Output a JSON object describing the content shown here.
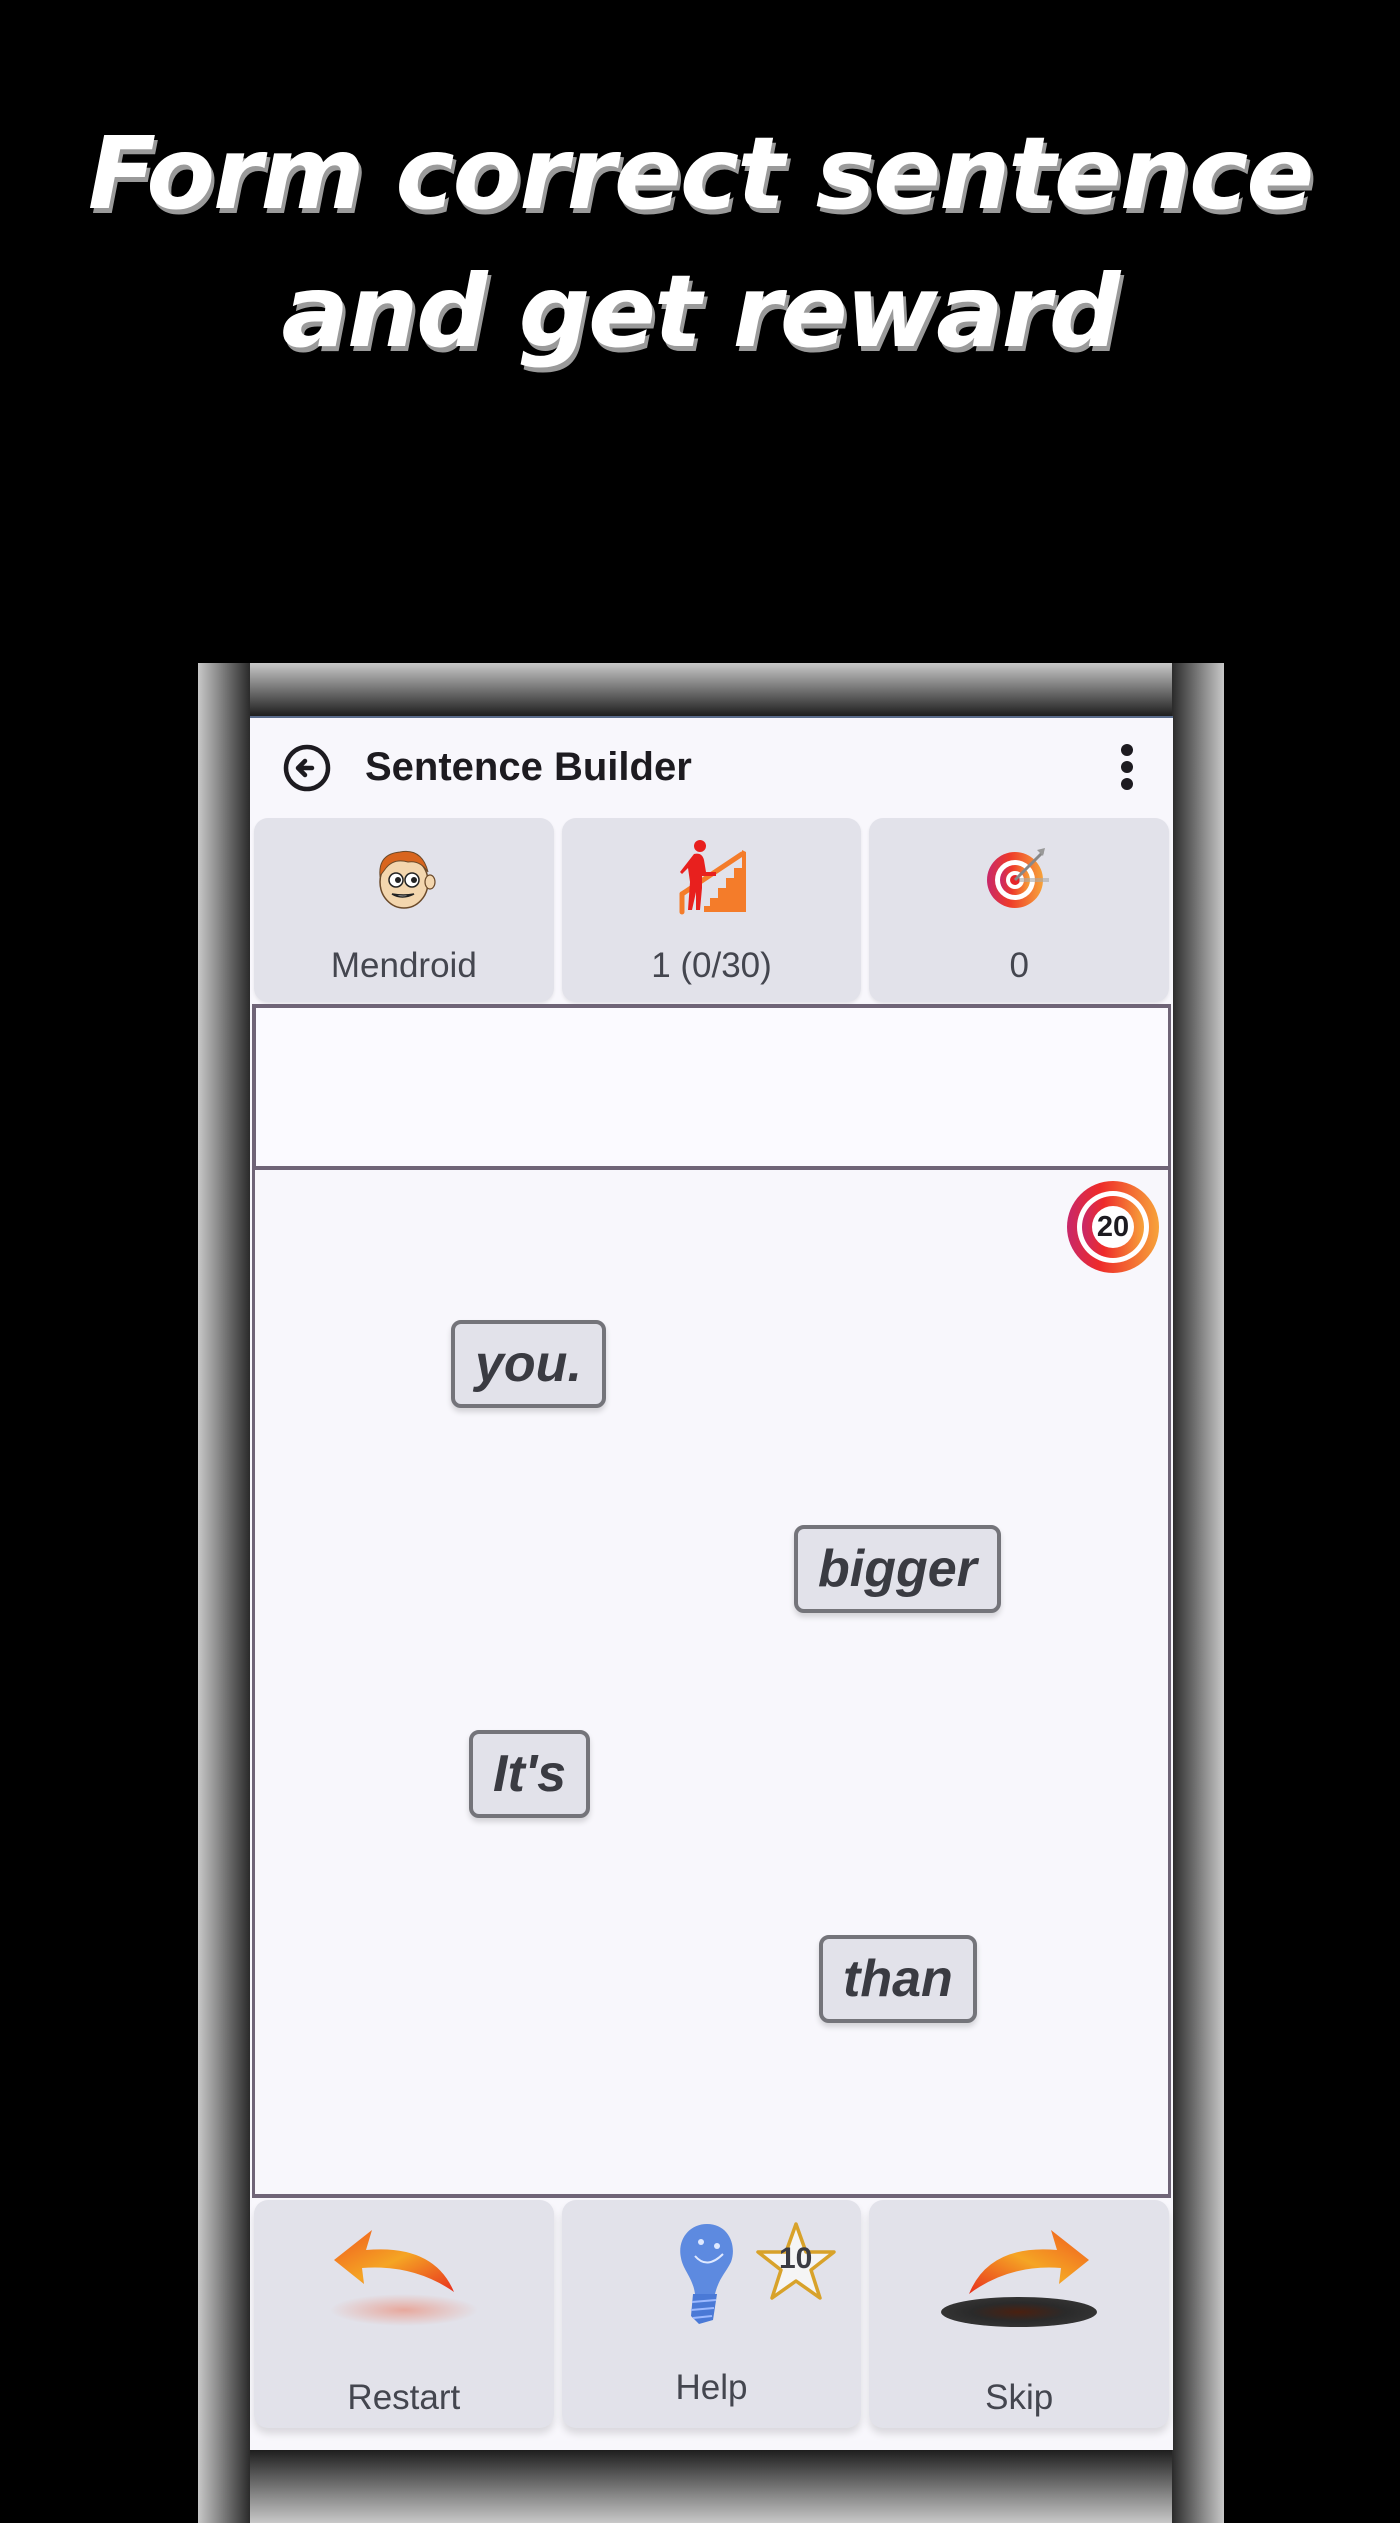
{
  "promo": {
    "line1": "Form correct sentence",
    "line2": "and get reward"
  },
  "app": {
    "title": "Sentence Builder",
    "back_icon": "circle-arrow-left-icon",
    "menu_icon": "more-vertical-icon"
  },
  "stats": [
    {
      "icon": "boy-face-avatar-icon",
      "label": "Mendroid"
    },
    {
      "icon": "climbing-stairs-icon",
      "label": "1 (0/30)"
    },
    {
      "icon": "target-arrow-icon",
      "label": "0"
    }
  ],
  "answer_area": {
    "text": ""
  },
  "timer": {
    "value": "20",
    "icon": "target-timer-icon"
  },
  "words": [
    {
      "text": "you."
    },
    {
      "text": "bigger"
    },
    {
      "text": "It's"
    },
    {
      "text": "than"
    }
  ],
  "actions": [
    {
      "icon": "curved-arrow-left-icon",
      "label": "Restart"
    },
    {
      "icon": "lightbulb-icon",
      "label": "Help",
      "badge": "10",
      "badge_icon": "star-icon"
    },
    {
      "icon": "curved-arrow-right-icon",
      "label": "Skip"
    }
  ],
  "colors": {
    "accent_orange": "#f47c2a",
    "accent_red": "#e8262a",
    "card_bg": "#e2e2ea",
    "screen_bg": "#f8f7fc",
    "border": "#6f6477"
  }
}
